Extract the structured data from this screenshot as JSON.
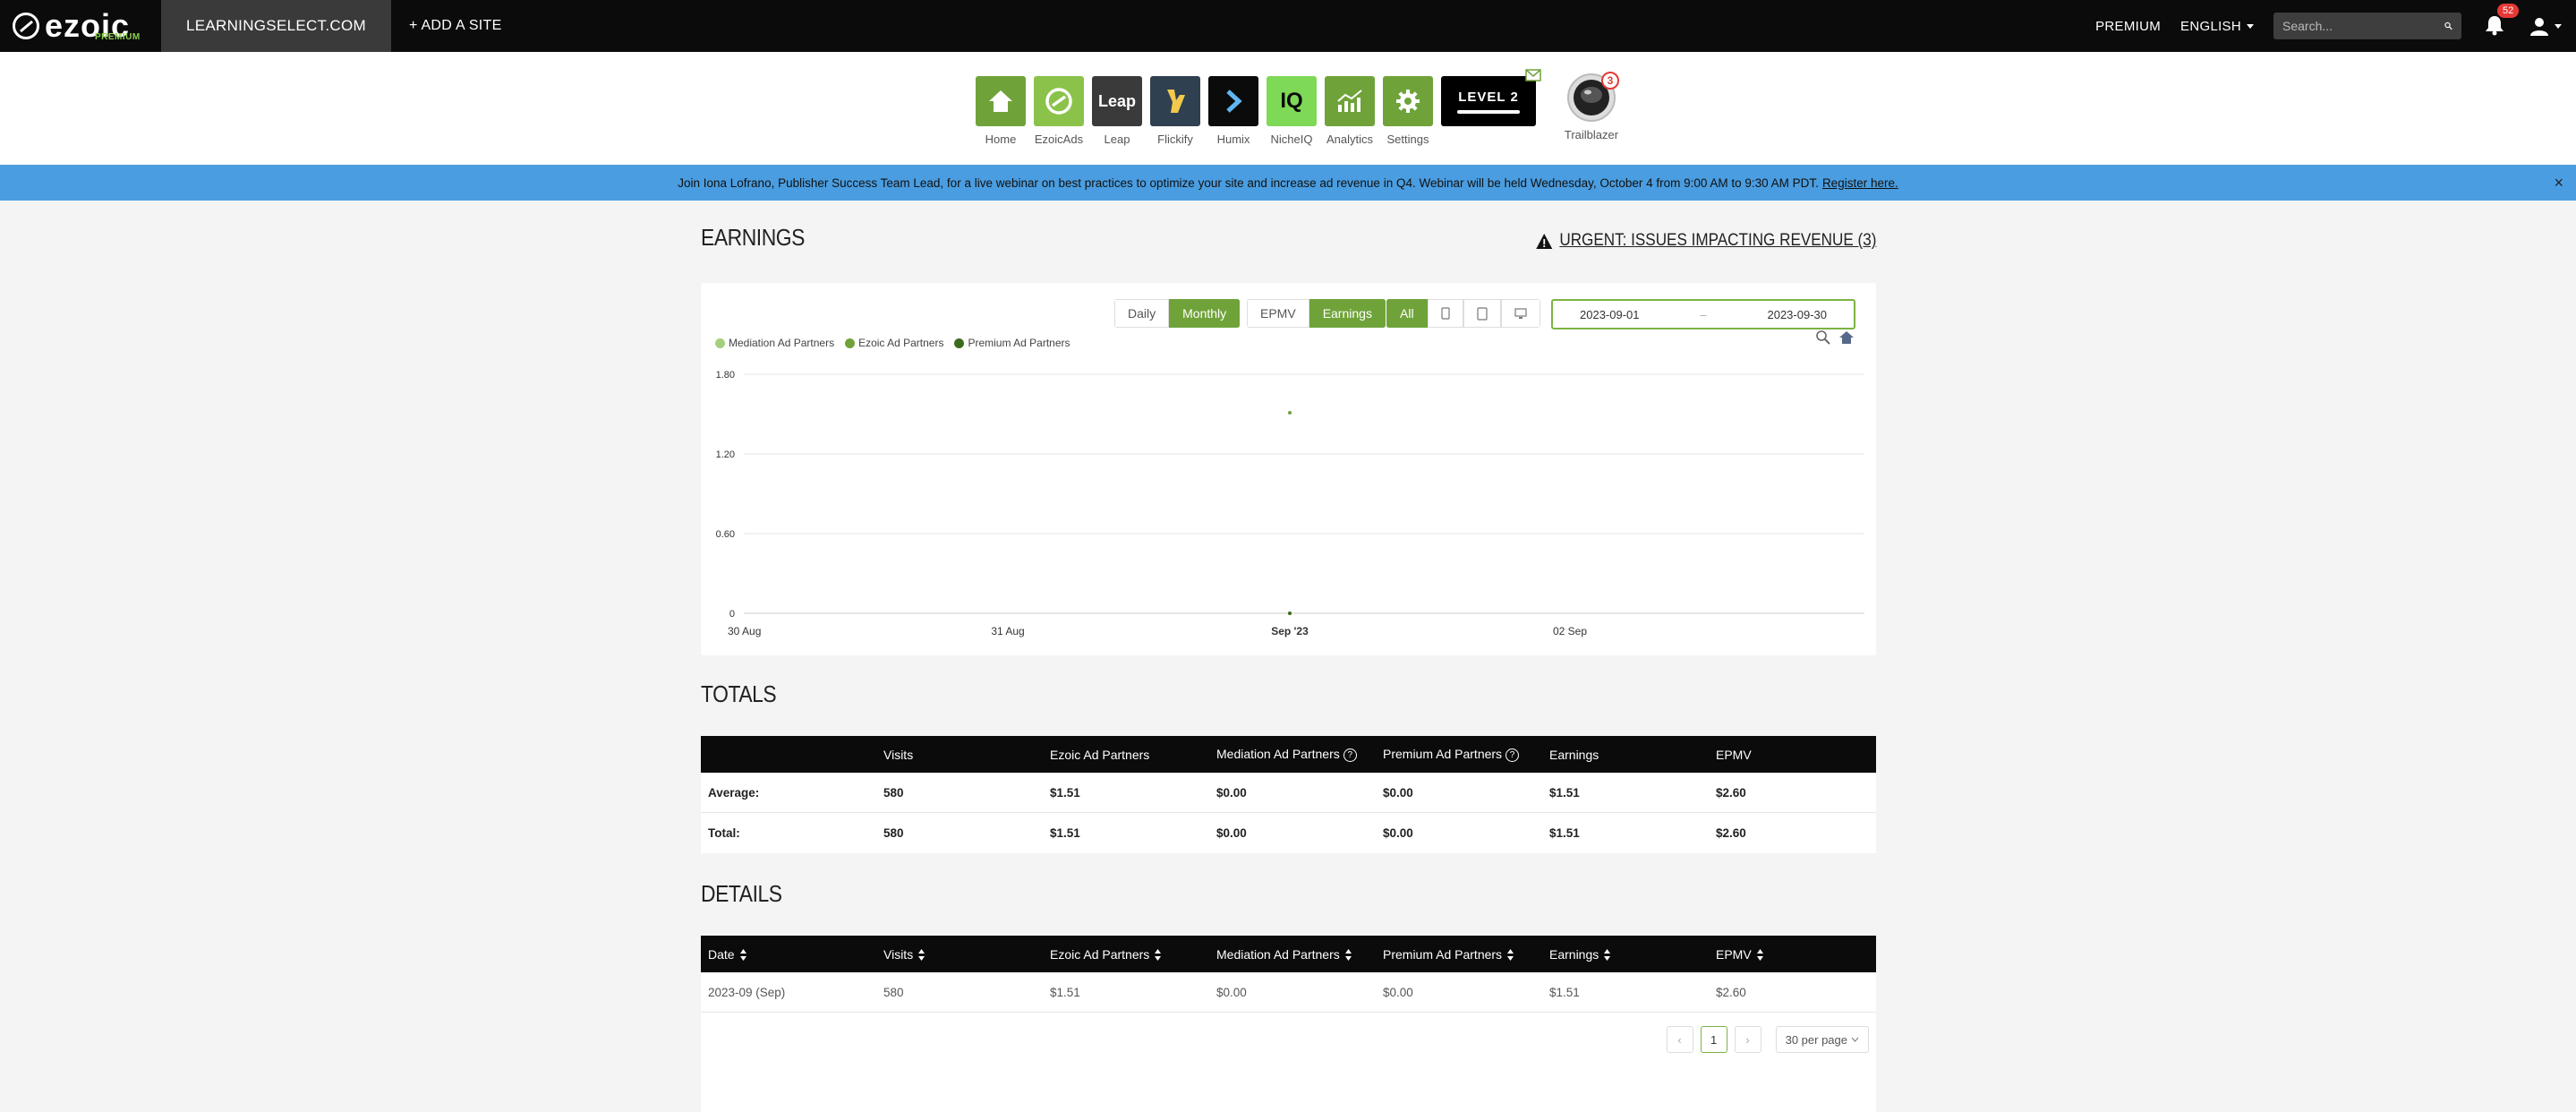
{
  "topbar": {
    "logo_text": "ezoic",
    "logo_sub": "PREMIUM",
    "site": "LEARNINGSELECT.COM",
    "add_site": "+ ADD A SITE",
    "premium": "PREMIUM",
    "language": "ENGLISH",
    "search_placeholder": "Search...",
    "notifications": "52"
  },
  "apps": [
    {
      "label": "Home",
      "color": "#6fa33a",
      "icon": "home-icon"
    },
    {
      "label": "EzoicAds",
      "color": "#8bc34a",
      "icon": "ezoic-ads-icon"
    },
    {
      "label": "Leap",
      "color": "#3a3a3a",
      "icon": "leap-icon",
      "tile_text": "Leap"
    },
    {
      "label": "Flickify",
      "color": "#2f4050",
      "icon": "flickify-icon"
    },
    {
      "label": "Humix",
      "color": "#0b0b0b",
      "icon": "humix-icon"
    },
    {
      "label": "NicheIQ",
      "color": "#7ed957",
      "icon": "nicheiq-icon",
      "tile_text": "IQ"
    },
    {
      "label": "Analytics",
      "color": "#6fa33a",
      "icon": "analytics-icon"
    },
    {
      "label": "Settings",
      "color": "#6fa33a",
      "icon": "gear-icon"
    }
  ],
  "level": {
    "text": "LEVEL 2"
  },
  "trailblazer": {
    "label": "Trailblazer",
    "badge": "3"
  },
  "announcement": {
    "text": "Join Iona Lofrano, Publisher Success Team Lead, for a live webinar on best practices to optimize your site and increase ad revenue in Q4. Webinar will be held Wednesday, October 4 from 9:00 AM to 9:30 AM PDT.",
    "link": "Register here.",
    "close": "×"
  },
  "earnings": {
    "title": "EARNINGS",
    "urgent": "URGENT: ISSUES IMPACTING REVENUE (3)",
    "period_buttons": [
      "Daily",
      "Monthly"
    ],
    "metric_buttons": [
      "EPMV",
      "Earnings"
    ],
    "device_all": "All",
    "date_start": "2023-09-01",
    "date_sep": "–",
    "date_end": "2023-09-30"
  },
  "chart_data": {
    "type": "line",
    "series": [
      {
        "name": "Mediation Ad Partners",
        "color": "#a5d07b",
        "x": [
          "Sep '23"
        ],
        "values": [
          0
        ]
      },
      {
        "name": "Ezoic Ad Partners",
        "color": "#6fa33a",
        "x": [
          "Sep '23"
        ],
        "values": [
          1.51
        ]
      },
      {
        "name": "Premium Ad Partners",
        "color": "#3d6b1e",
        "x": [
          "Sep '23"
        ],
        "values": [
          0
        ]
      }
    ],
    "x_ticks": [
      "30 Aug",
      "31 Aug",
      "Sep '23",
      "02 Sep"
    ],
    "y_ticks": [
      "0",
      "0.60",
      "1.20",
      "1.80"
    ],
    "ylim": [
      0,
      1.8
    ],
    "grid": true,
    "legend_position": "top-left"
  },
  "totals": {
    "title": "TOTALS",
    "headers": [
      "",
      "Visits",
      "Ezoic Ad Partners",
      "Mediation Ad Partners",
      "Premium Ad Partners",
      "Earnings",
      "EPMV"
    ],
    "rows": [
      [
        "Average:",
        "580",
        "$1.51",
        "$0.00",
        "$0.00",
        "$1.51",
        "$2.60"
      ],
      [
        "Total:",
        "580",
        "$1.51",
        "$0.00",
        "$0.00",
        "$1.51",
        "$2.60"
      ]
    ]
  },
  "details": {
    "title": "DETAILS",
    "headers": [
      "Date",
      "Visits",
      "Ezoic Ad Partners",
      "Mediation Ad Partners",
      "Premium Ad Partners",
      "Earnings",
      "EPMV"
    ],
    "rows": [
      [
        "2023-09 (Sep)",
        "580",
        "$1.51",
        "$0.00",
        "$0.00",
        "$1.51",
        "$2.60"
      ]
    ],
    "pagination": {
      "prev": "‹",
      "page": "1",
      "next": "›",
      "per_page": "30 per page"
    }
  }
}
